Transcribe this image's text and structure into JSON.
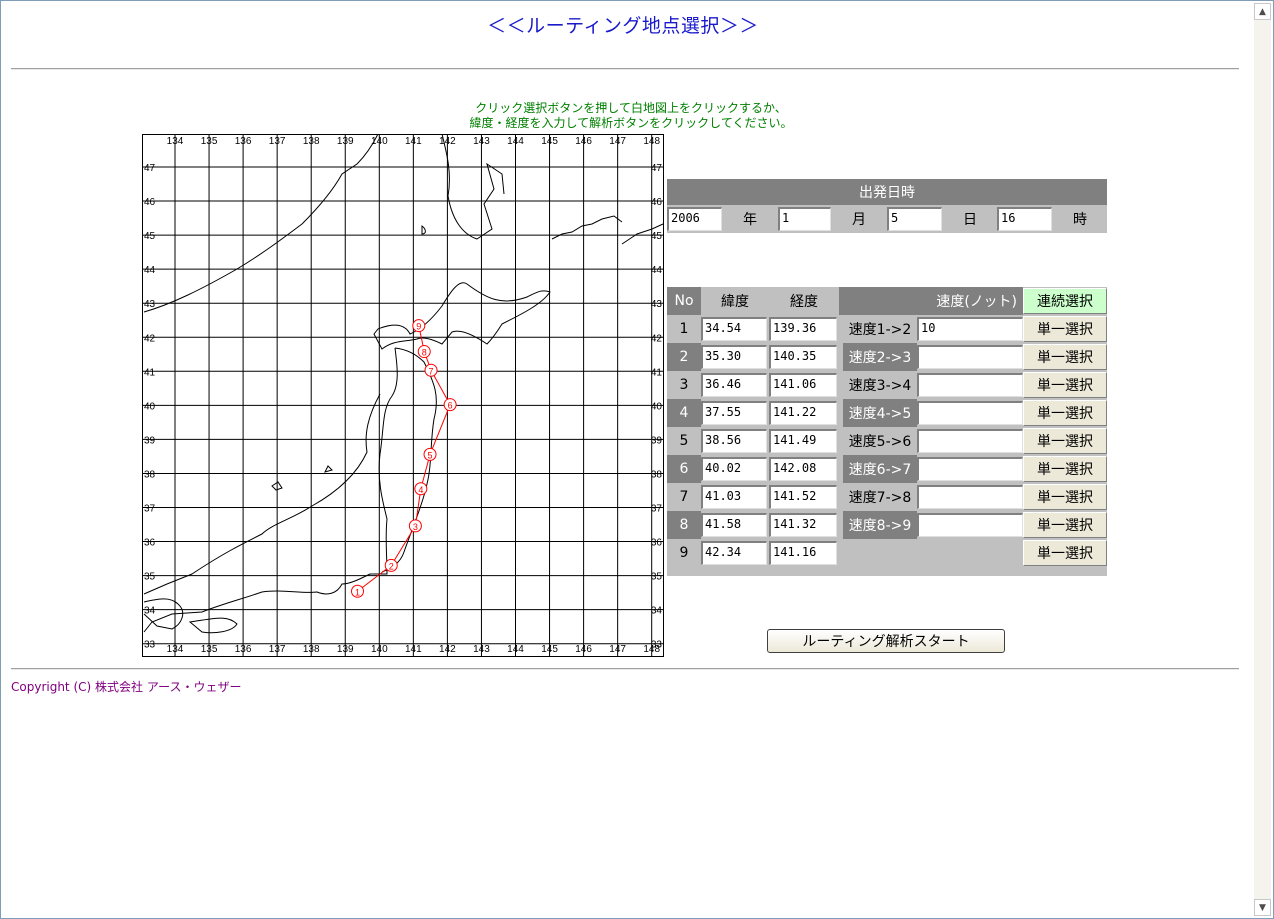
{
  "page_title": "＜＜ルーティング地点選択＞＞",
  "instructions": {
    "line1": "クリック選択ボタンを押して白地図上をクリックするか、",
    "line2": "緯度・経度を入力して解析ボタンをクリックしてください。"
  },
  "map": {
    "lon_labels": [
      "134",
      "135",
      "136",
      "137",
      "138",
      "139",
      "140",
      "141",
      "142",
      "143",
      "144",
      "145",
      "146",
      "147",
      "148"
    ],
    "lat_labels": [
      "47",
      "46",
      "45",
      "44",
      "43",
      "42",
      "41",
      "40",
      "39",
      "38",
      "37",
      "36",
      "35",
      "34",
      "33"
    ],
    "route_color": "#ff0000"
  },
  "departure": {
    "header": "出発日時",
    "year_value": "2006",
    "year_unit": "年",
    "month_value": "1",
    "month_unit": "月",
    "day_value": "5",
    "day_unit": "日",
    "hour_value": "16",
    "hour_unit": "時"
  },
  "points": {
    "col_no": "No",
    "col_lat": "緯度",
    "col_lon": "経度",
    "col_speed": "速度(ノット)",
    "continuous_select": "連続選択",
    "single_select": "単一選択",
    "rows": [
      {
        "no": "1",
        "lat": "34.54",
        "lon": "139.36",
        "speed_label": "速度1->2",
        "speed": "10"
      },
      {
        "no": "2",
        "lat": "35.30",
        "lon": "140.35",
        "speed_label": "速度2->3",
        "speed": ""
      },
      {
        "no": "3",
        "lat": "36.46",
        "lon": "141.06",
        "speed_label": "速度3->4",
        "speed": ""
      },
      {
        "no": "4",
        "lat": "37.55",
        "lon": "141.22",
        "speed_label": "速度4->5",
        "speed": ""
      },
      {
        "no": "5",
        "lat": "38.56",
        "lon": "141.49",
        "speed_label": "速度5->6",
        "speed": ""
      },
      {
        "no": "6",
        "lat": "40.02",
        "lon": "142.08",
        "speed_label": "速度6->7",
        "speed": ""
      },
      {
        "no": "7",
        "lat": "41.03",
        "lon": "141.52",
        "speed_label": "速度7->8",
        "speed": ""
      },
      {
        "no": "8",
        "lat": "41.58",
        "lon": "141.32",
        "speed_label": "速度8->9",
        "speed": ""
      },
      {
        "no": "9",
        "lat": "42.34",
        "lon": "141.16",
        "speed_label": "",
        "speed": ""
      }
    ]
  },
  "start_button": "ルーティング解析スタート",
  "copyright": "Copyright (C) 株式会社 アース・ウェザー",
  "icons": {
    "scroll_up": "triangle-up",
    "scroll_down": "triangle-down"
  }
}
